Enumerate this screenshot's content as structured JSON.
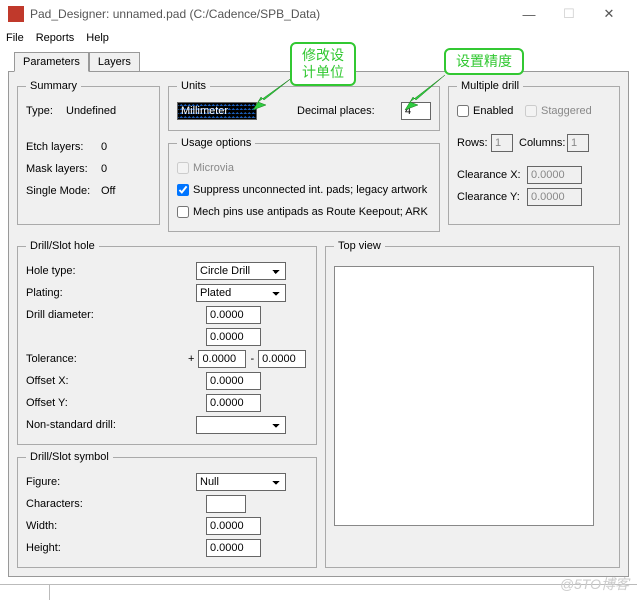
{
  "window": {
    "title": "Pad_Designer: unnamed.pad (C:/Cadence/SPB_Data)"
  },
  "menu": {
    "file": "File",
    "reports": "Reports",
    "help": "Help"
  },
  "annotations": {
    "units": "修改设\n计单位",
    "precision": "设置精度"
  },
  "tabs": {
    "parameters": "Parameters",
    "layers": "Layers"
  },
  "summary": {
    "legend": "Summary",
    "type_label": "Type:",
    "type_value": "Undefined",
    "etch_label": "Etch layers:",
    "etch_value": "0",
    "mask_label": "Mask layers:",
    "mask_value": "0",
    "single_label": "Single Mode:",
    "single_value": "Off"
  },
  "units": {
    "legend": "Units",
    "unit_value": "Millimeter",
    "decimal_label": "Decimal places:",
    "decimal_value": "4"
  },
  "usage": {
    "legend": "Usage options",
    "microvia": "Microvia",
    "suppress": "Suppress unconnected int. pads; legacy artwork",
    "mech": "Mech pins use antipads as Route Keepout; ARK"
  },
  "mdrill": {
    "legend": "Multiple drill",
    "enabled": "Enabled",
    "staggered": "Staggered",
    "rows_label": "Rows:",
    "rows_value": "1",
    "cols_label": "Columns:",
    "cols_value": "1",
    "clearx_label": "Clearance X:",
    "clearx_value": "0.0000",
    "cleary_label": "Clearance Y:",
    "cleary_value": "0.0000"
  },
  "drillhole": {
    "legend": "Drill/Slot hole",
    "holetype_label": "Hole type:",
    "holetype_value": "Circle Drill",
    "plating_label": "Plating:",
    "plating_value": "Plated",
    "diam_label": "Drill diameter:",
    "diam_value": "0.0000",
    "diam_value2": "0.0000",
    "tol_label": "Tolerance:",
    "tol_plus": "+",
    "tol_minus": "-",
    "tol1": "0.0000",
    "tol2": "0.0000",
    "offx_label": "Offset X:",
    "offx_value": "0.0000",
    "offy_label": "Offset Y:",
    "offy_value": "0.0000",
    "nonstd_label": "Non-standard drill:"
  },
  "drillsym": {
    "legend": "Drill/Slot symbol",
    "figure_label": "Figure:",
    "figure_value": "Null",
    "chars_label": "Characters:",
    "chars_value": "",
    "width_label": "Width:",
    "width_value": "0.0000",
    "height_label": "Height:",
    "height_value": "0.0000"
  },
  "topview": {
    "legend": "Top view"
  },
  "watermark": "@5\u0019TO博客"
}
